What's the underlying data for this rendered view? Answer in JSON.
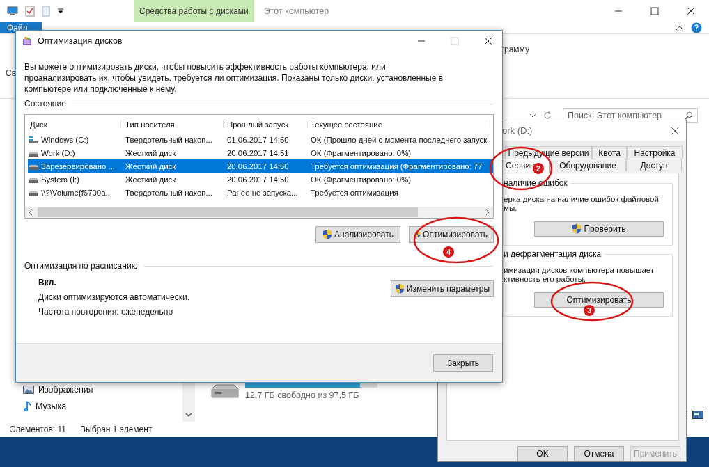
{
  "explorer": {
    "title": "Этот компьютер",
    "contextual_group": "Средства работы с дисками",
    "ribbon_tabs": [
      {
        "label": "Файл",
        "kind": "file"
      }
    ],
    "ribbon_fragment": "грамму",
    "pane_fragment": "Св",
    "search": {
      "placeholder": "Поиск: Этот компьютер"
    },
    "nav_items": [
      {
        "label": "Изображения",
        "kind": "pictures"
      },
      {
        "label": "Музыка",
        "kind": "music"
      }
    ],
    "drive": {
      "free_text": "12,7 ГБ свободно из 97,5 ГБ",
      "level": 0.87
    },
    "status_bar": [
      "Элементов: 11",
      "Выбран 1 элемент"
    ]
  },
  "properties": {
    "title": "ork (D:)",
    "tab_rows": [
      [
        {
          "label": "Предыдущие версии",
          "selected": false
        },
        {
          "label": "Квота",
          "selected": false
        },
        {
          "label": "Настройка",
          "selected": false
        }
      ],
      [
        {
          "label": "Сервис",
          "selected": true
        },
        {
          "label": "Оборудование",
          "selected": false
        },
        {
          "label": "Доступ",
          "selected": false
        }
      ]
    ],
    "groups": [
      {
        "title": "наличие ошибок",
        "lines": [
          "ерка диска на наличие ошибок файловой",
          "мы."
        ],
        "button": {
          "label": "Проверить",
          "shield": true
        }
      },
      {
        "title": "и дефрагментация диска",
        "lines": [
          "имизация дисков компьютера повышает",
          "ктивность его работы."
        ],
        "button": {
          "label": "Оптимизировать",
          "shield": false
        }
      }
    ],
    "buttons": [
      {
        "label": "OK",
        "disabled": false
      },
      {
        "label": "Отмена",
        "disabled": false
      },
      {
        "label": "Применить",
        "disabled": true
      }
    ]
  },
  "defrag": {
    "title": "Оптимизация дисков",
    "description": "Вы можете оптимизировать диски, чтобы повысить эффективность работы  компьютера, или проанализировать их, чтобы увидеть, требуется ли оптимизация. Показаны только диски, установленные в компьютере или подключенные к нему.",
    "status_heading": "Состояние",
    "columns": [
      "Диск",
      "Тип носителя",
      "Прошлый запуск",
      "Текущее состояние"
    ],
    "rows": [
      {
        "kind": "system",
        "selected": false,
        "cells": [
          "Windows (C:)",
          "Твердотельный накоп...",
          "01.06.2017 14:50",
          "ОК (Прошло дней с момента последнего запуск"
        ]
      },
      {
        "kind": "drive",
        "selected": false,
        "cells": [
          "Work (D:)",
          "Жесткий диск",
          "20.06.2017 14:51",
          "ОК (Фрагментировано: 0%)"
        ]
      },
      {
        "kind": "drive",
        "selected": true,
        "cells": [
          "Зарезервировано ...",
          "Жесткий диск",
          "20.06.2017 14:50",
          "Требуется оптимизация (Фрагментировано: 77"
        ]
      },
      {
        "kind": "drive",
        "selected": false,
        "cells": [
          "System (I:)",
          "Жесткий диск",
          "20.06.2017 14:50",
          "ОК (Фрагментировано: 0%)"
        ]
      },
      {
        "kind": "drive",
        "selected": false,
        "cells": [
          "\\\\?\\Volume{f6700a...",
          "Твердотельный накоп...",
          "Ранее не запуска...",
          "Требуется оптимизация"
        ]
      }
    ],
    "actions": [
      "Анализировать",
      "Оптимизировать"
    ],
    "schedule": {
      "heading": "Оптимизация по расписанию",
      "state": "Вкл.",
      "lines": [
        "Диски оптимизируются автоматически.",
        "Частота повторения: еженедельно"
      ],
      "button": "Изменить параметры"
    },
    "close_button": "Закрыть"
  },
  "annotations": [
    {
      "number": "2"
    },
    {
      "number": "4"
    },
    {
      "number": "3"
    }
  ]
}
